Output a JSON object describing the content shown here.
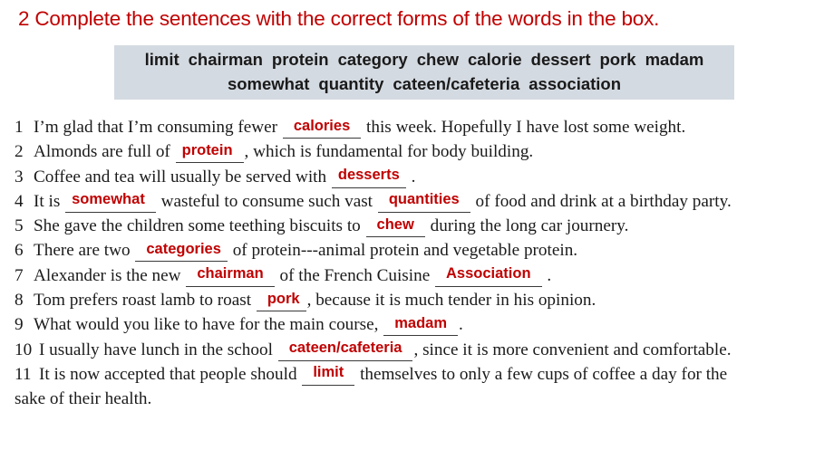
{
  "exercise": {
    "number": "2",
    "instruction": "2 Complete the sentences with the correct forms of the words in the box.",
    "title_color": "#C00000"
  },
  "word_bank": {
    "background_color": "#d4dae1",
    "rows": [
      [
        "limit",
        "chairman",
        "protein",
        "category",
        "chew",
        "calorie",
        "dessert",
        "pork",
        "madam"
      ],
      [
        "somewhat",
        "quantity",
        "cateen/cafeteria",
        "association"
      ]
    ]
  },
  "sentences": [
    {
      "number": "1",
      "before": "I’m glad that I’m consuming fewer",
      "answer": "calories",
      "after": "this week. Hopefully I have lost some weight."
    },
    {
      "number": "2",
      "before": "Almonds are full of",
      "answer": "protein",
      "after": ", which is fundamental for body building."
    },
    {
      "number": "3",
      "before": "Coffee and tea will usually be served with",
      "answer": "desserts",
      "after": "."
    },
    {
      "number": "4",
      "before": "It is",
      "answer": "somewhat",
      "middle": "wasteful to consume such vast",
      "answer2": "quantities",
      "after": "of food and drink at a birthday party."
    },
    {
      "number": "5",
      "before": "She gave the children some teething biscuits to",
      "answer": "chew",
      "after": "during the long car journery."
    },
    {
      "number": "6",
      "before": "There are two",
      "answer": "categories",
      "after": "of protein---animal protein and vegetable protein."
    },
    {
      "number": "7",
      "before": "Alexander is the new",
      "answer": "chairman",
      "middle": "of the French Cuisine",
      "answer2": "Association",
      "after": "."
    },
    {
      "number": "8",
      "before": "Tom prefers roast lamb to roast",
      "answer": "pork",
      "after": ", because it is much tender in his opinion."
    },
    {
      "number": "9",
      "before": "What would you like to have for the main course,",
      "answer": "madam",
      "after": "."
    },
    {
      "number": "10",
      "before": "I usually have lunch in the school",
      "answer": "cateen/cafeteria",
      "after": ", since it is more convenient and comfortable."
    },
    {
      "number": "11",
      "before": "It is now accepted that people should",
      "answer": "limit",
      "after": "themselves to only a few cups of coffee a day for the",
      "continuation": "sake of their health."
    }
  ],
  "answer_color": "#C00000"
}
